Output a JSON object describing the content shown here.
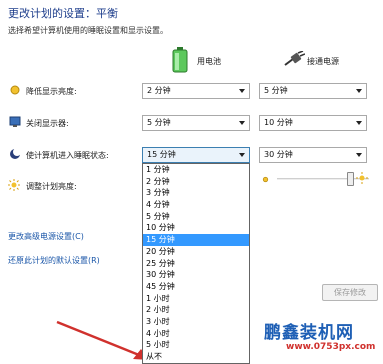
{
  "header": {
    "title": "更改计划的设置：平衡",
    "subtitle": "选择希望计算机使用的睡眠设置和显示设置。"
  },
  "columns": {
    "battery": "用电池",
    "plugged": "接通电源"
  },
  "rows": {
    "dim": {
      "label": "降低显示亮度:",
      "battery": "2 分钟",
      "plugged": "5 分钟"
    },
    "display_off": {
      "label": "关闭显示器:",
      "battery": "5 分钟",
      "plugged": "10 分钟"
    },
    "sleep": {
      "label": "使计算机进入睡眠状态:",
      "battery": "15 分钟",
      "plugged": "30 分钟"
    },
    "brightness": {
      "label": "调整计划亮度:",
      "plugged_level": 0.8
    }
  },
  "dropdown": {
    "options": [
      "1 分钟",
      "2 分钟",
      "3 分钟",
      "4 分钟",
      "5 分钟",
      "10 分钟",
      "15 分钟",
      "20 分钟",
      "25 分钟",
      "30 分钟",
      "45 分钟",
      "1 小时",
      "2 小时",
      "3 小时",
      "4 小时",
      "5 小时",
      "从不"
    ],
    "selected_index": 6
  },
  "links": {
    "advanced": "更改高级电源设置(C)",
    "restore": "还原此计划的默认设置(R)"
  },
  "buttons": {
    "save": "保存修改"
  },
  "watermark": {
    "logo": "鹏鑫装机网",
    "url": "www.0753px.com"
  },
  "colors": {
    "title": "#1e3e8c",
    "link": "#1a56a8",
    "highlight": "#3399ff",
    "arrow": "#d0312d"
  }
}
